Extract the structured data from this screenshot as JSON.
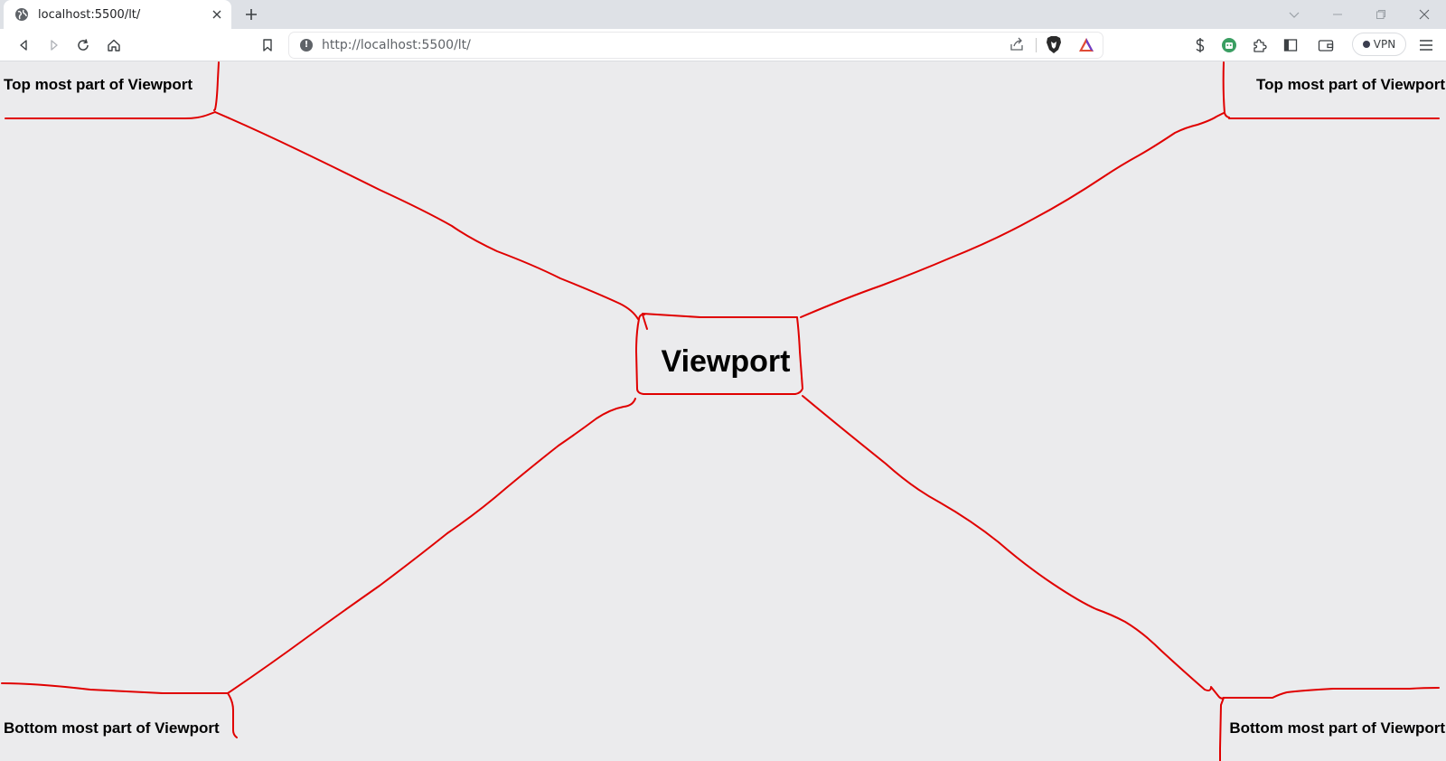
{
  "browser": {
    "tab": {
      "title": "localhost:5500/lt/"
    },
    "address_bar": {
      "url": "http://localhost:5500/lt/"
    },
    "vpn_label": "VPN"
  },
  "page": {
    "center_label": "Viewport",
    "corner_labels": {
      "top_left": "Top most part of Viewport",
      "top_right": "Top most part of Viewport",
      "bottom_left": "Bottom most part of Viewport",
      "bottom_right": "Bottom most part of Viewport"
    },
    "annotation_color": "#e00000"
  }
}
